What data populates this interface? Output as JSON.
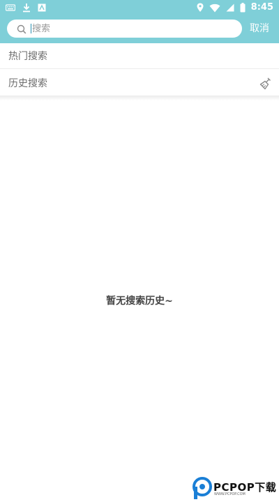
{
  "status_bar": {
    "time": "8:45",
    "left_icons": [
      "keyboard-icon",
      "download-icon",
      "app-icon"
    ],
    "right_icons": [
      "location-icon",
      "wifi-icon",
      "signal-icon",
      "battery-icon"
    ]
  },
  "search": {
    "placeholder": "搜索",
    "value": "",
    "cancel_label": "取消"
  },
  "sections": {
    "hot_title": "热门搜索",
    "history_title": "历史搜索"
  },
  "empty_state": {
    "message": "暂无搜索历史~"
  },
  "watermark": {
    "text": "PCPOP下载",
    "sub": "WWW.PCPOP.COM"
  },
  "colors": {
    "header_bg": "#7fcfd8",
    "background": "#ffffff",
    "watermark_blue": "#1a7fd6"
  }
}
